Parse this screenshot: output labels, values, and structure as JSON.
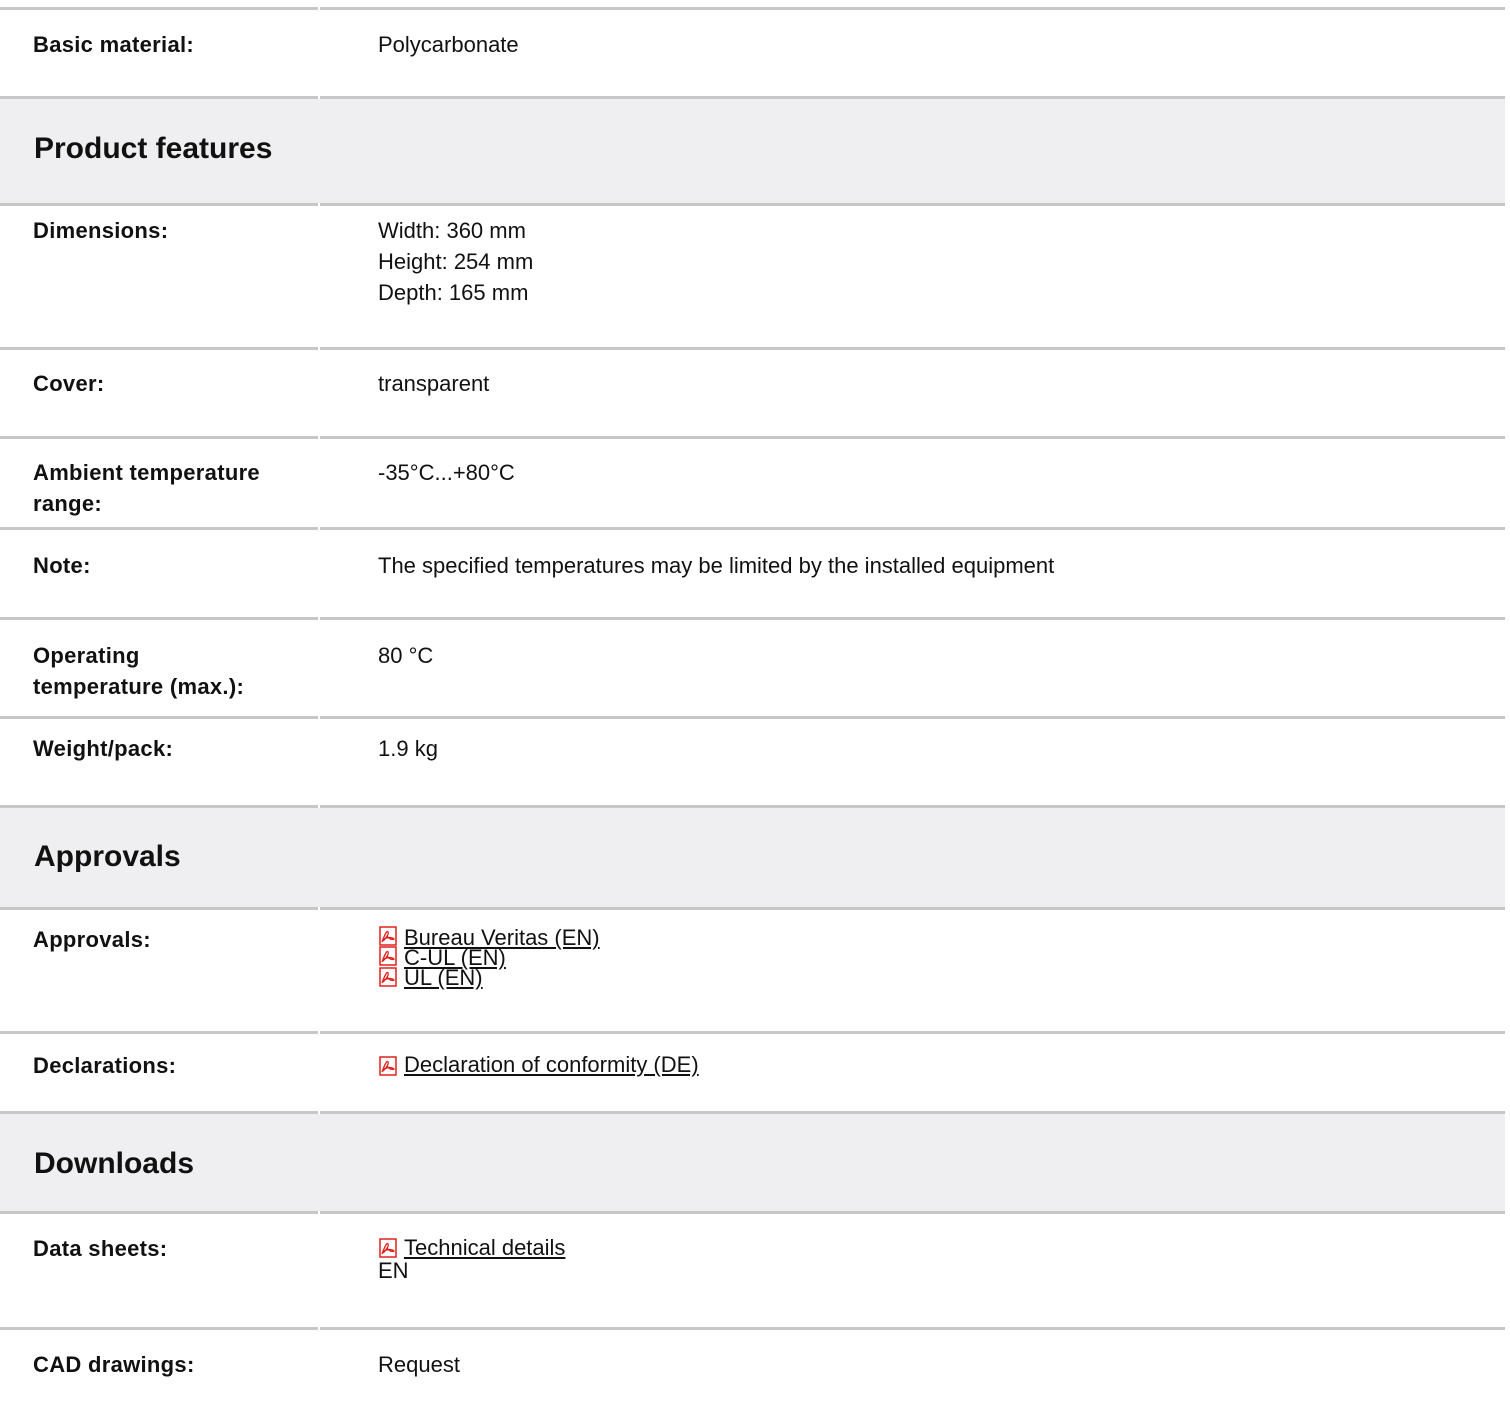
{
  "rows_top": {
    "basic_material": {
      "label": "Basic material:",
      "value": "Polycarbonate"
    }
  },
  "sections": {
    "product_features": "Product features",
    "approvals": "Approvals",
    "downloads": "Downloads"
  },
  "product_features": {
    "dimensions": {
      "label": "Dimensions:",
      "width": "Width: 360 mm",
      "height": "Height: 254 mm",
      "depth": "Depth: 165 mm"
    },
    "cover": {
      "label": "Cover:",
      "value": "transparent"
    },
    "ambient_temperature": {
      "label_line1": "Ambient temperature",
      "label_line2": "range:",
      "value": "-35°C...+80°C"
    },
    "note": {
      "label": "Note:",
      "value": "The specified temperatures may be limited by the installed equipment"
    },
    "operating_temperature": {
      "label_line1": "Operating",
      "label_line2": "temperature (max.):",
      "value": "80 °C"
    },
    "weight": {
      "label": "Weight/pack:",
      "value": "1.9 kg"
    }
  },
  "approvals": {
    "approvals_row": {
      "label": "Approvals:",
      "links": [
        "Bureau Veritas (EN)",
        "C-UL (EN)",
        "UL (EN)"
      ]
    },
    "declarations": {
      "label": "Declarations:",
      "link": "Declaration of conformity (DE)"
    }
  },
  "downloads": {
    "data_sheets": {
      "label": "Data sheets:",
      "link": "Technical details",
      "language": "EN"
    },
    "cad": {
      "label": "CAD drawings:",
      "value": "Request"
    }
  },
  "colors": {
    "separator": "#c7c7c7",
    "section_bg": "#efeff1",
    "pdf_icon": "#e0201b"
  }
}
